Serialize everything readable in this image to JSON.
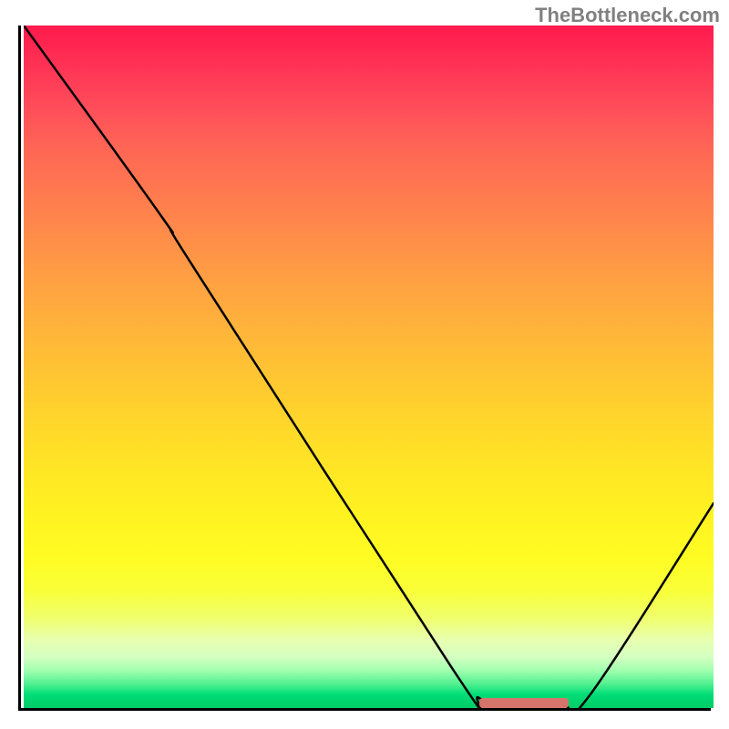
{
  "attribution": "TheBottleneck.com",
  "chart_data": {
    "type": "line",
    "title": "",
    "xlabel": "",
    "ylabel": "",
    "xlim": [
      0,
      100
    ],
    "ylim": [
      0,
      100
    ],
    "curve_points": [
      {
        "x": 0,
        "y": 100
      },
      {
        "x": 20,
        "y": 72
      },
      {
        "x": 25,
        "y": 64
      },
      {
        "x": 62,
        "y": 6
      },
      {
        "x": 66,
        "y": 1.5
      },
      {
        "x": 70,
        "y": 0.4
      },
      {
        "x": 78,
        "y": 0.4
      },
      {
        "x": 82,
        "y": 1.8
      },
      {
        "x": 100,
        "y": 30
      }
    ],
    "marker": {
      "x_start": 66,
      "x_end": 79,
      "y": 0.8
    },
    "gradient_stops": [
      {
        "pos": 0,
        "color": "#ff1a4d"
      },
      {
        "pos": 50,
        "color": "#ffcc2f"
      },
      {
        "pos": 80,
        "color": "#fffc22"
      },
      {
        "pos": 100,
        "color": "#00cc66"
      }
    ]
  }
}
